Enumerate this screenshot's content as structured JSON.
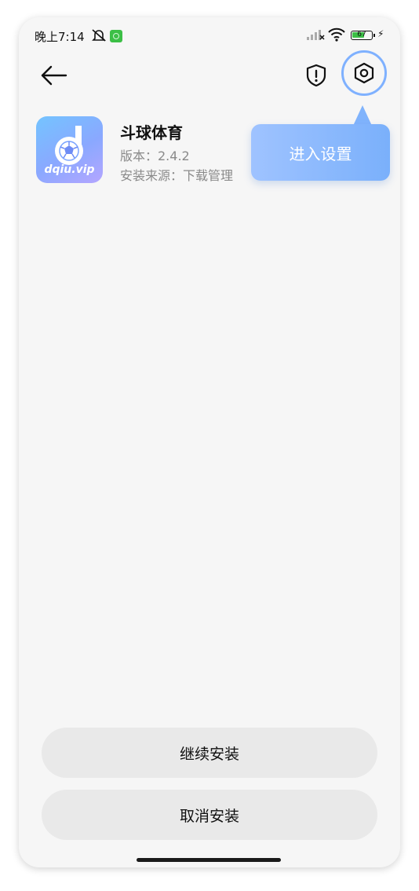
{
  "status_bar": {
    "time": "晚上7:14",
    "battery_level": "67",
    "battery_fraction": 0.67,
    "icons": [
      "mute-icon",
      "app-notification-icon",
      "signal-icon",
      "wifi-icon",
      "battery-icon",
      "charging-icon"
    ]
  },
  "header": {
    "back_icon": "arrow-left-icon",
    "shield_icon": "shield-alert-icon",
    "settings_icon": "settings-hex-icon"
  },
  "tooltip": {
    "text": "进入设置"
  },
  "app": {
    "icon_text": "dqiu.vip",
    "name": "斗球体育",
    "version": "版本：2.4.2",
    "source": "安装来源：下载管理"
  },
  "actions": {
    "continue_label": "继续安装",
    "cancel_label": "取消安装"
  },
  "colors": {
    "accent": "#7fb1ff",
    "background": "#f6f6f6",
    "button": "#e9e9e9"
  }
}
